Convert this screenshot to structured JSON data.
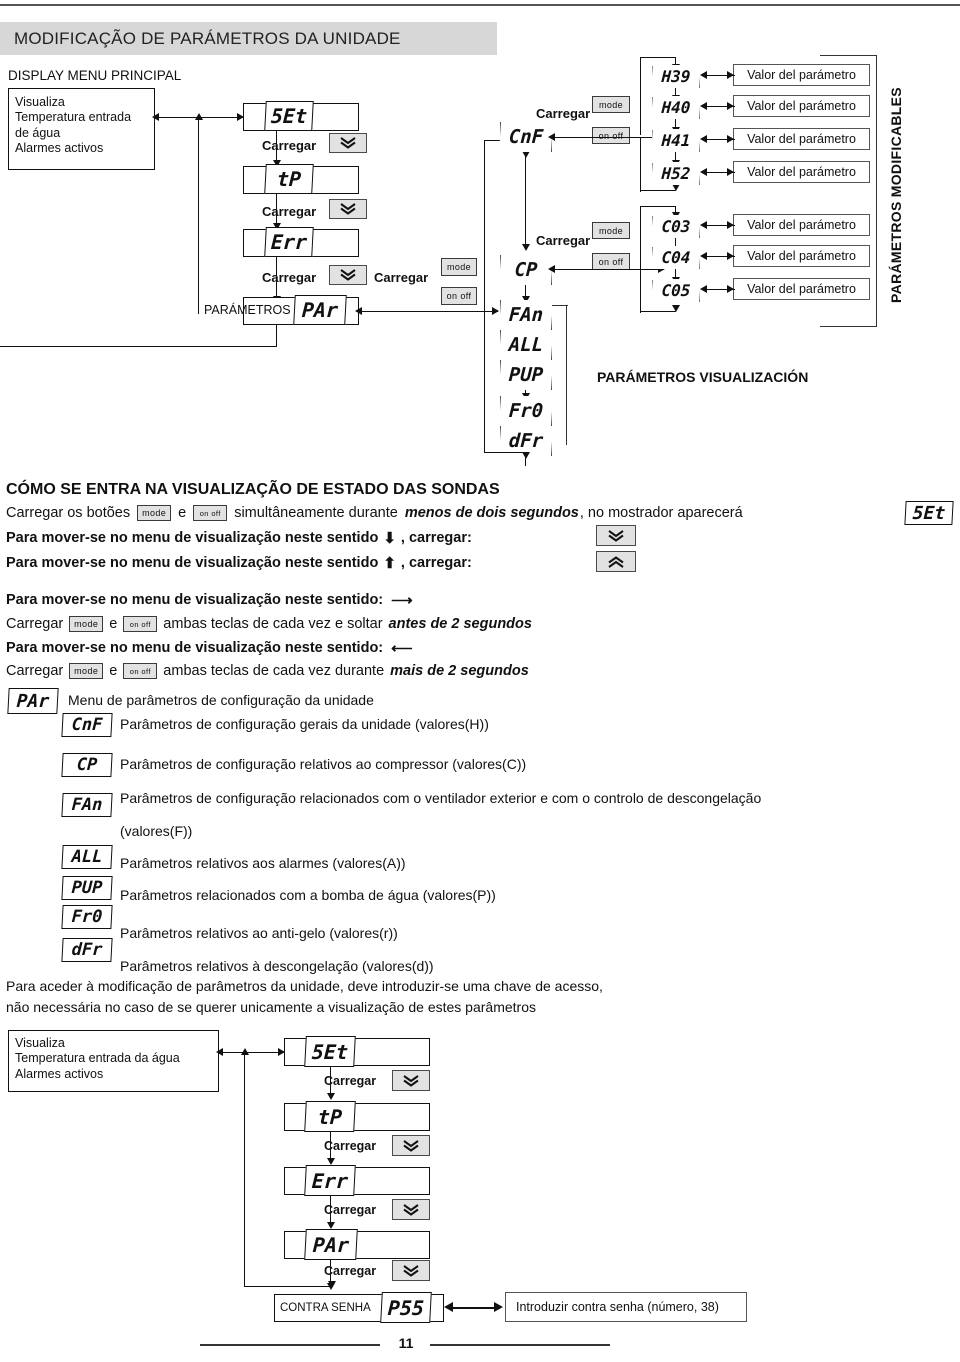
{
  "page": {
    "title": "MODIFICAÇÃO DE PARÁMETROS DA UNIDADE",
    "number": "11"
  },
  "top_diagram": {
    "caption": "DISPLAY MENU PRINCIPAL",
    "status_box": {
      "line1": "Visualiza",
      "line2": "Temperatura entrada",
      "line3": "de água",
      "line4": "Alarmes activos"
    },
    "menu_chain": [
      {
        "code": "5Et",
        "press": "Carregar"
      },
      {
        "code": "tP",
        "press": "Carregar"
      },
      {
        "code": "Err",
        "press": "Carregar"
      },
      {
        "code": "PAr",
        "prefix": "PARÁMETROS",
        "press": "Carregar"
      }
    ],
    "press_label": "Carregar",
    "keys": {
      "mode": "mode",
      "onoff": "on  off"
    },
    "param_groups": [
      "CnF",
      "CP",
      "FAn",
      "ALL",
      "PUP",
      "Fr0",
      "dFr"
    ],
    "modifiable_params": [
      {
        "code": "H39",
        "value_label": "Valor del parámetro"
      },
      {
        "code": "H40",
        "value_label": "Valor del parámetro"
      },
      {
        "code": "H41",
        "value_label": "Valor del parámetro"
      },
      {
        "code": "H52",
        "value_label": "Valor del parámetro"
      }
    ],
    "compressor_params": [
      {
        "code": "C03",
        "value_label": "Valor del parámetro"
      },
      {
        "code": "C04",
        "value_label": "Valor del parámetro"
      },
      {
        "code": "C05",
        "value_label": "Valor del parámetro"
      }
    ],
    "vertical_caption": "PARÁMETROS MODIFICABLES",
    "visual_caption": "PARÁMETROS VISUALIZACIÓN"
  },
  "instructions": {
    "heading": "CÓMO SE ENTRA NA VISUALIZAÇÃO DE ESTADO DAS SONDAS",
    "line1_a": "Carregar os botões",
    "line1_b": "e",
    "line1_c": "simultâneamente durante",
    "line1_d": "menos de dois segundos",
    "line1_e": ", no mostrador aparecerá",
    "line1_display": "5Et",
    "down_line": "Para mover-se no menu de visualização neste sentido",
    "down_line_tail": ", carregar:",
    "up_line": "Para mover-se no menu de visualização neste sentido",
    "up_line_tail": ", carregar:",
    "right_dir_line": "Para mover-se no menu de visualização neste sentido:",
    "right_dir_body_a": "Carregar",
    "right_dir_body_b": "e",
    "right_dir_body_c": "ambas teclas  de cada vez e soltar",
    "right_dir_body_d": "antes de 2 segundos",
    "left_dir_line": "Para mover-se no menu de visualização neste sentido:",
    "left_dir_body_a": "Carregar",
    "left_dir_body_b": "e",
    "left_dir_body_c": "ambas teclas  de cada vez durante",
    "left_dir_body_d": "mais de 2 segundos",
    "keys": {
      "mode": "mode",
      "onoff": "on off"
    }
  },
  "param_legend": [
    {
      "code": "PAr",
      "text": "Menu de parâmetros de configuração da unidade"
    },
    {
      "code": "CnF",
      "text": "Parâmetros de configuração gerais da unidade (valores(H))"
    },
    {
      "code": "CP",
      "text": "Parâmetros de configuração relativos ao compressor (valores(C))"
    },
    {
      "code": "FAn",
      "text": "Parâmetros de configuração relacionados com o ventilador exterior e com o controlo de descongelação"
    },
    {
      "code": "",
      "text": "(valores(F))"
    },
    {
      "code": "ALL",
      "text": "Parâmetros relativos aos alarmes (valores(A))"
    },
    {
      "code": "PUP",
      "text": "Parâmetros relacionados com a bomba de água (valores(P))"
    },
    {
      "code": "Fr0",
      "text": "Parâmetros relativos ao anti-gelo (valores(r))"
    },
    {
      "code": "dFr",
      "text": "Parâmetros relativos à descongelação (valores(d))"
    }
  ],
  "access_note": {
    "line1": "Para aceder à modificação de parâmetros da unidade, deve introduzir-se uma chave de acesso,",
    "line2": "não necessária no caso de se querer unicamente a visualização de estes parâmetros"
  },
  "bottom_diagram": {
    "status_box": {
      "line1": "Visualiza",
      "line2": "Temperatura entrada da água",
      "line3": "Alarmes activos"
    },
    "chain": [
      {
        "code": "5Et",
        "press": "Carregar"
      },
      {
        "code": "tP",
        "press": "Carregar"
      },
      {
        "code": "Err",
        "press": "Carregar"
      },
      {
        "code": "PAr",
        "press": "Carregar"
      }
    ],
    "password_label": "CONTRA SENHA",
    "password_code": "P55",
    "password_note": "Introduzir contra senha (número, 38)"
  }
}
